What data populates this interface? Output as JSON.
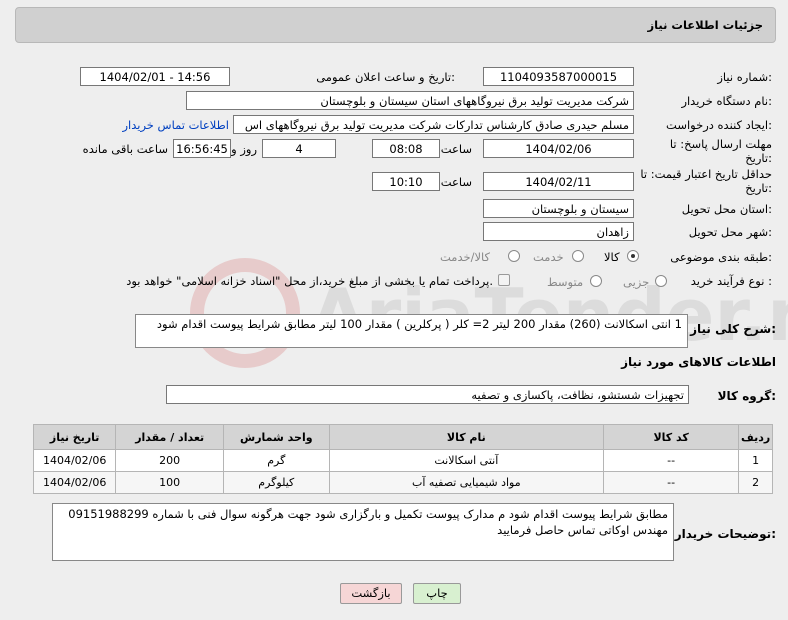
{
  "page": {
    "title": "جزئیات اطلاعات نیاز"
  },
  "fields": {
    "need_number_label": "شماره نیاز:",
    "need_number": "1104093587000015",
    "announce_label": "تاریخ و ساعت اعلان عمومی:",
    "announce_value": "1404/02/01 - 14:56",
    "buyer_org_label": "نام دستگاه خریدار:",
    "buyer_org": "شرکت مدیریت تولید برق نیروگاههای استان سیستان و بلوچستان",
    "creator_label": "ایجاد کننده درخواست:",
    "creator": "مسلم حیدری صادق کارشناس تدارکات شرکت مدیریت تولید برق نیروگاههای اس",
    "contact_link": "اطلاعات تماس خریدار",
    "reply_deadline_label": "مهلت ارسال پاسخ: تا تاریخ:",
    "reply_date": "1404/02/06",
    "time_label": "ساعت",
    "reply_time": "08:08",
    "days": "4",
    "days_label": "روز و",
    "remaining_time": "16:56:45",
    "remaining_label": "ساعت باقی مانده",
    "validity_label": "حداقل تاریخ اعتبار قیمت: تا تاریخ:",
    "validity_date": "1404/02/11",
    "validity_time": "10:10",
    "province_label": "استان محل تحویل:",
    "province": "سیستان و بلوچستان",
    "city_label": "شهر محل تحویل:",
    "city": "زاهدان",
    "category_label": "طبقه بندی موضوعی:",
    "category_options": [
      "کالا",
      "خدمت",
      "کالا/خدمت"
    ],
    "process_label": "نوع فرآیند خرید :",
    "process_options": [
      "جزیی",
      "متوسط"
    ],
    "payment_note": "پرداخت تمام یا بخشی از مبلغ خرید،از محل \"اسناد خزانه اسلامی\" خواهد بود.",
    "summary_label": "شرح کلی نیاز:",
    "summary": "1  انتی اسکالانت (260)  مقدار 200 لیتر   2= کلر ( پرکلرین )  مقدار  100 لیتر  مطابق شرایط پیوست اقدام شود"
  },
  "goods": {
    "section_title": "اطلاعات کالاهای مورد نیاز",
    "group_label": "گروه کالا:",
    "group_value": "تجهیزات شستشو، نظافت، پاکسازی و تصفیه",
    "columns": [
      "ردیف",
      "کد کالا",
      "نام کالا",
      "واحد شمارش",
      "تعداد / مقدار",
      "تاریخ نیاز"
    ],
    "rows": [
      [
        "1",
        "--",
        "آنتی اسکالانت",
        "گرم",
        "200",
        "1404/02/06"
      ],
      [
        "2",
        "--",
        "مواد شیمیایی تصفیه آب",
        "کیلوگرم",
        "100",
        "1404/02/06"
      ]
    ]
  },
  "buyer_notes": {
    "label": "توضیحات خریدار:",
    "text": "مطابق شرایط پیوست اقدام شود م مدارک پیوست تکمیل و بارگزاری شود  جهت هرگونه سوال فنی با شماره 09151988299 مهندس اوکاتی تماس حاصل فرمایید"
  },
  "buttons": {
    "print": "چاپ",
    "back": "بازگشت"
  },
  "watermark": "AriaTender.neT",
  "colors": {
    "header_bg": "#d0d0d0",
    "page_bg": "#eeeeee",
    "link": "#0040c0",
    "back_btn": "#f6d6d6",
    "print_btn": "#d8f0d0"
  }
}
